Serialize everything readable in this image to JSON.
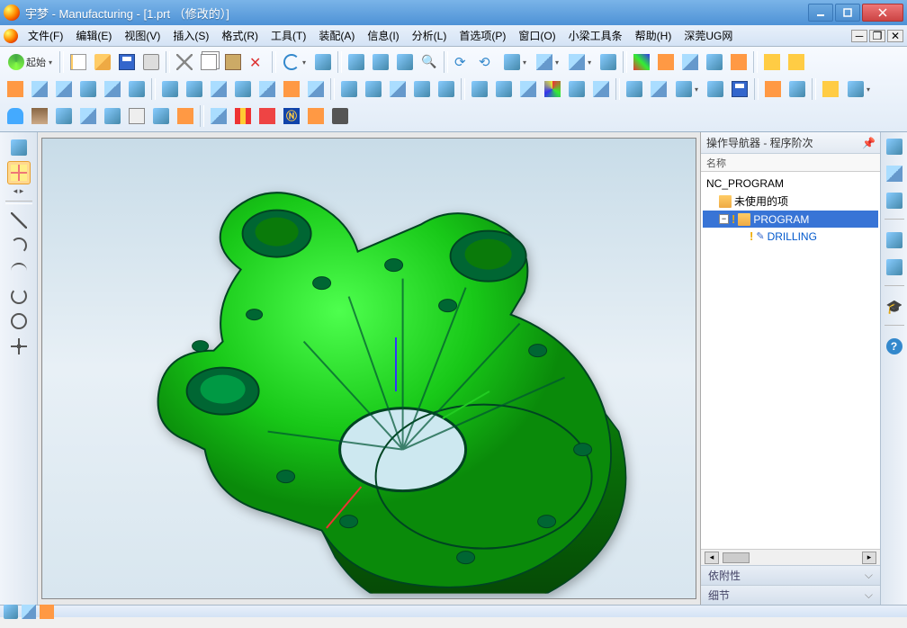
{
  "window": {
    "title": "宇梦 - Manufacturing - [1.prt （修改的）]"
  },
  "menu": {
    "items": [
      "文件(F)",
      "编辑(E)",
      "视图(V)",
      "插入(S)",
      "格式(R)",
      "工具(T)",
      "装配(A)",
      "信息(I)",
      "分析(L)",
      "首选项(P)",
      "窗口(O)",
      "小梁工具条",
      "帮助(H)",
      "深莞UG网"
    ]
  },
  "start_label": "起始",
  "nav": {
    "title": "操作导航器 - 程序阶次",
    "col_header": "名称",
    "root": "NC_PROGRAM",
    "unused": "未使用的项",
    "program": "PROGRAM",
    "drilling": "DRILLING",
    "dependency": "依附性",
    "details": "细节"
  }
}
